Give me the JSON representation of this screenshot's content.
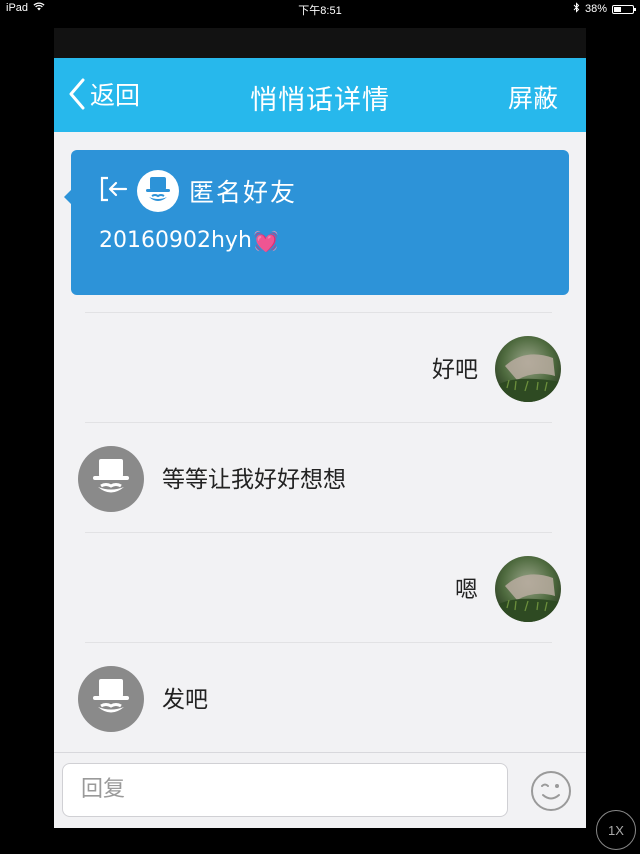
{
  "status_bar": {
    "device": "iPad",
    "time": "下午8:51",
    "battery_percent": "38%",
    "battery_level": 0.38
  },
  "nav": {
    "back_label": "返回",
    "title": "悄悄话详情",
    "right_label": "屏蔽"
  },
  "card": {
    "name": "匿名好友",
    "topic": "20160902hyh",
    "topic_emoji": "💓"
  },
  "messages": [
    {
      "side": "right",
      "text": "好吧"
    },
    {
      "side": "left",
      "text": "等等让我好好想想"
    },
    {
      "side": "right",
      "text": "嗯"
    },
    {
      "side": "left",
      "text": "发吧"
    }
  ],
  "input": {
    "placeholder": "回复"
  },
  "overlay": {
    "zoom_label": "1X"
  },
  "colors": {
    "nav_bg": "#27b8ec",
    "card_bg": "#2d93d8",
    "chat_bg": "#f2f2f4"
  }
}
